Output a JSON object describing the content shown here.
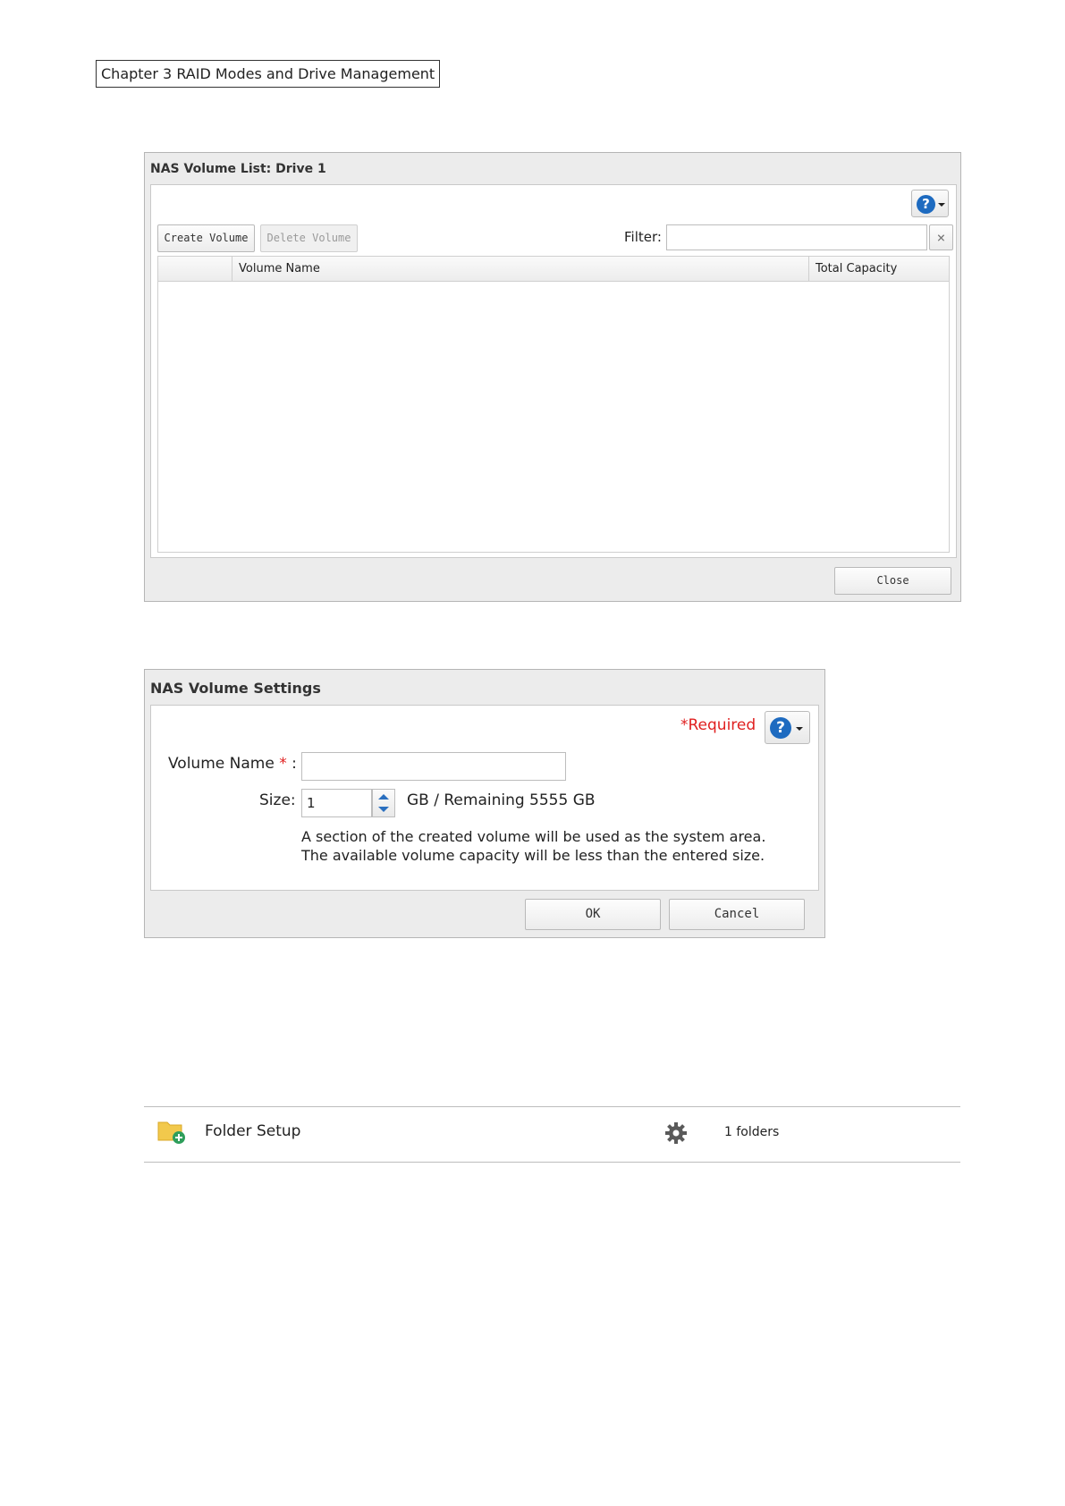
{
  "chapter_header": "Chapter 3 RAID Modes and Drive Management",
  "volume_list_dialog": {
    "title": "NAS Volume List: Drive 1",
    "help_icon": "question-icon",
    "create_button": "Create Volume",
    "delete_button": "Delete Volume",
    "filter_label": "Filter:",
    "filter_value": "",
    "clear_icon": "×",
    "columns": [
      "",
      "Volume Name",
      "Total Capacity"
    ],
    "rows": [],
    "close_button": "Close"
  },
  "volume_settings_dialog": {
    "title": "NAS Volume Settings",
    "required_note": "*Required",
    "help_icon": "question-icon",
    "volume_name_label": "Volume Name",
    "required_mark": "*",
    "colon": ":",
    "volume_name_value": "",
    "size_label": "Size:",
    "size_value": "1",
    "size_suffix": "GB / Remaining 5555 GB",
    "note_line1": "A section of the created volume will be used as the system area.",
    "note_line2": "The available volume capacity will be less than the entered size.",
    "ok_button": "OK",
    "cancel_button": "Cancel"
  },
  "folder_row": {
    "icon": "folder-add-icon",
    "label": "Folder Setup",
    "settings_icon": "gear-icon",
    "count": "1 folders"
  },
  "colors": {
    "accent_blue": "#1e6bc0",
    "required_red": "#e02020",
    "folder_yellow": "#f2c94c",
    "plus_green": "#2e9e5b"
  }
}
